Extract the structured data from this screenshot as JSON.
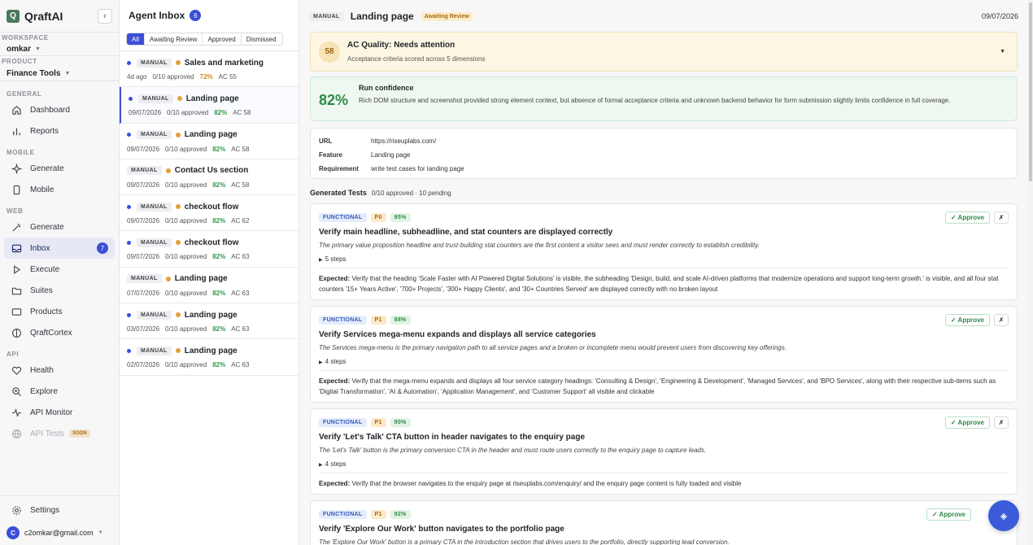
{
  "sidebar": {
    "brand": "QraftAI",
    "logo_letter": "Q",
    "collapse_glyph": "‹",
    "workspace_label": "WORKSPACE",
    "workspace": "omkar",
    "product_label": "PRODUCT",
    "product": "Finance Tools",
    "sections": {
      "general": "GENERAL",
      "mobile": "MOBILE",
      "web": "WEB",
      "api": "API"
    },
    "items": {
      "dashboard": "Dashboard",
      "reports": "Reports",
      "mobile_generate": "Generate",
      "mobile": "Mobile",
      "web_generate": "Generate",
      "inbox": "Inbox",
      "inbox_count": "7",
      "execute": "Execute",
      "suites": "Suites",
      "products": "Products",
      "qraftcortex": "QraftCortex",
      "health": "Health",
      "explore": "Explore",
      "api_monitor": "API Monitor",
      "api_tests": "API Tests",
      "soon": "SOON"
    },
    "settings": "Settings",
    "user_initial": "C",
    "user_email": "c2omkar@gmail.com"
  },
  "inbox": {
    "title": "Agent Inbox",
    "count": "6",
    "filters": [
      "All",
      "Awaiting Review",
      "Approved",
      "Dismissed"
    ],
    "items": [
      {
        "tag": "MANUAL",
        "title": "Sales and marketing",
        "date": "4d ago",
        "approved": "0/10 approved",
        "pct": "72%",
        "ac": "AC 55"
      },
      {
        "tag": "MANUAL",
        "title": "Landing page",
        "date": "09/07/2026",
        "approved": "0/10 approved",
        "pct": "82%",
        "ac": "AC 58"
      },
      {
        "tag": "MANUAL",
        "title": "Landing page",
        "date": "09/07/2026",
        "approved": "0/10 approved",
        "pct": "82%",
        "ac": "AC 58"
      },
      {
        "tag": "MANUAL",
        "title": "Contact Us section",
        "date": "09/07/2026",
        "approved": "0/10 approved",
        "pct": "82%",
        "ac": "AC 58"
      },
      {
        "tag": "MANUAL",
        "title": "checkout flow",
        "date": "09/07/2026",
        "approved": "0/10 approved",
        "pct": "82%",
        "ac": "AC 62"
      },
      {
        "tag": "MANUAL",
        "title": "checkout flow",
        "date": "09/07/2026",
        "approved": "0/10 approved",
        "pct": "82%",
        "ac": "AC 63"
      },
      {
        "tag": "MANUAL",
        "title": "Landing page",
        "date": "07/07/2026",
        "approved": "0/10 approved",
        "pct": "82%",
        "ac": "AC 63"
      },
      {
        "tag": "MANUAL",
        "title": "Landing page",
        "date": "03/07/2026",
        "approved": "0/10 approved",
        "pct": "82%",
        "ac": "AC 63"
      },
      {
        "tag": "MANUAL",
        "title": "Landing page",
        "date": "02/07/2026",
        "approved": "0/10 approved",
        "pct": "82%",
        "ac": "AC 63"
      }
    ]
  },
  "main": {
    "tag": "MANUAL",
    "title": "Landing page",
    "status": "Awaiting Review",
    "date": "09/07/2026",
    "ac": {
      "score": "58",
      "title": "AC Quality: Needs attention",
      "subtitle": "Acceptance criteria scored across 5 dimensions",
      "chevron": "▼"
    },
    "confidence": {
      "value": "82%",
      "title": "Run confidence",
      "text": "Rich DOM structure and screenshot provided strong element context, but absence of formal acceptance criteria and unknown backend behavior for form submission slightly limits confidence in full coverage."
    },
    "info": {
      "url_label": "URL",
      "url": "https://riseuplabs.com/",
      "feature_label": "Feature",
      "feature": "Landing page",
      "req_label": "Requirement",
      "requirement": "write test cases for landing page"
    },
    "generated": {
      "title": "Generated Tests",
      "summary": "0/10 approved · 10 pending"
    },
    "tests": [
      {
        "type": "FUNCTIONAL",
        "priority": "P0",
        "score": "95%",
        "title": "Verify main headline, subheadline, and stat counters are displayed correctly",
        "desc": "The primary value proposition headline and trust-building stat counters are the first content a visitor sees and must render correctly to establish credibility.",
        "steps": "5 steps",
        "expected_label": "Expected:",
        "expected": "Verify that the heading 'Scale Faster with AI Powered Digital Solutions' is visible, the subheading 'Design, build, and scale AI-driven platforms that modernize operations and support long-term growth.' is visible, and all four stat counters '15+ Years Active', '700+ Projects', '300+ Happy Clients', and '30+ Countries Served' are displayed correctly with no broken layout"
      },
      {
        "type": "FUNCTIONAL",
        "priority": "P1",
        "score": "88%",
        "title": "Verify Services mega-menu expands and displays all service categories",
        "desc": "The Services mega-menu is the primary navigation path to all service pages and a broken or incomplete menu would prevent users from discovering key offerings.",
        "steps": "4 steps",
        "expected_label": "Expected:",
        "expected": "Verify that the mega-menu expands and displays all four service category headings: 'Consulting & Design', 'Engineering & Development', 'Managed Services', and 'BPO Services', along with their respective sub-items such as 'Digital Transformation', 'AI & Automation', 'Application Management', and 'Customer Support' all visible and clickable"
      },
      {
        "type": "FUNCTIONAL",
        "priority": "P1",
        "score": "90%",
        "title": "Verify 'Let's Talk' CTA button in header navigates to the enquiry page",
        "desc": "The 'Let's Talk' button is the primary conversion CTA in the header and must route users correctly to the enquiry page to capture leads.",
        "steps": "4 steps",
        "expected_label": "Expected:",
        "expected": "Verify that the browser navigates to the enquiry page at riseuplabs.com/enquiry/ and the enquiry page content is fully loaded and visible"
      },
      {
        "type": "FUNCTIONAL",
        "priority": "P1",
        "score": "92%",
        "title": "Verify 'Explore Our Work' button navigates to the portfolio page",
        "desc": "The 'Explore Our Work' button is a primary CTA in the introduction section that drives users to the portfolio, directly supporting lead conversion.",
        "steps": "",
        "expected_label": "",
        "expected": ""
      }
    ],
    "approve_label": "✓ Approve",
    "reject_label": "✗"
  },
  "fab_icon": "◈"
}
